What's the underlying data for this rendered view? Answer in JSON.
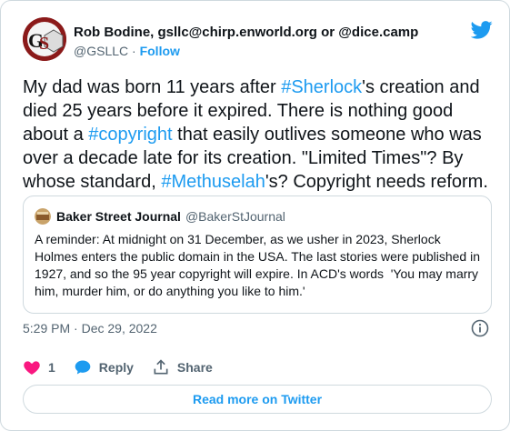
{
  "author": {
    "name": "Rob Bodine, gsllc@chirp.enworld.org or @dice.camp",
    "handle": "@GSLLC",
    "separator": " · ",
    "follow_label": "Follow"
  },
  "tweet": {
    "segments": [
      {
        "text": "My dad was born 11 years after ",
        "tag": false
      },
      {
        "text": "#Sherlock",
        "tag": true
      },
      {
        "text": "'s creation and died 25 years before it expired. There is nothing good about a ",
        "tag": false
      },
      {
        "text": "#copyright",
        "tag": true
      },
      {
        "text": " that easily outlives someone who was over a decade late for its creation. \"Limited Times\"? By whose standard, ",
        "tag": false
      },
      {
        "text": "#Methuselah",
        "tag": true
      },
      {
        "text": "'s? Copyright needs reform.",
        "tag": false
      }
    ]
  },
  "quote": {
    "name": "Baker Street Journal",
    "handle": "@BakerStJournal",
    "text": "A reminder: At midnight on 31 December, as we usher in 2023, Sherlock Holmes enters the public domain in the USA. The last stories were published in 1927, and so the 95 year copyright will expire. In ACD's words  'You may marry him, murder him, or do anything you like to him.'"
  },
  "meta": {
    "timestamp": "5:29 PM · Dec 29, 2022"
  },
  "actions": {
    "like_count": "1",
    "reply_label": "Reply",
    "share_label": "Share"
  },
  "read_more_label": "Read more on Twitter",
  "colors": {
    "accent": "#1d9bf0",
    "like": "#f91880",
    "text": "#0f1419",
    "muted": "#536471",
    "border": "#cfd9de"
  },
  "icons": [
    "gs-logo-avatar",
    "twitter-bird-icon",
    "bsj-avatar",
    "info-icon",
    "heart-icon",
    "reply-bubble-icon",
    "share-icon"
  ]
}
